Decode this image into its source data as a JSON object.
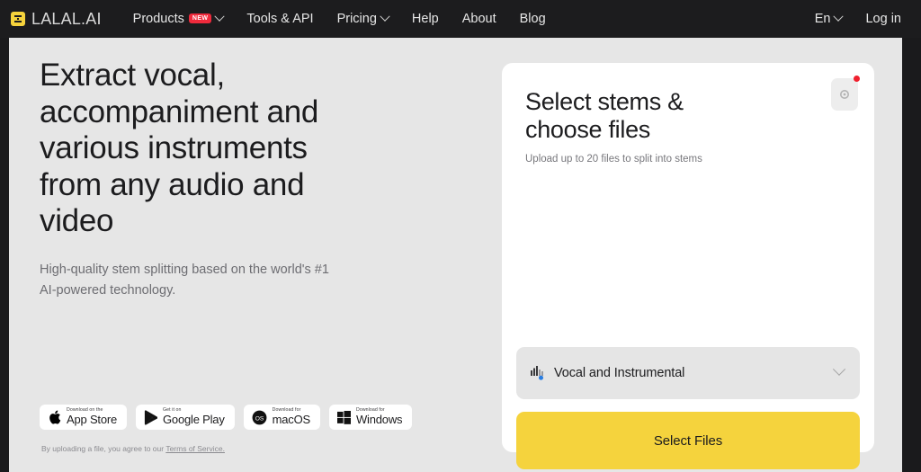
{
  "nav": {
    "brand": "LALAL.AI",
    "items": [
      {
        "label": "Products",
        "badge": "NEW",
        "caret": true
      },
      {
        "label": "Tools & API",
        "caret": false
      },
      {
        "label": "Pricing",
        "caret": true
      },
      {
        "label": "Help",
        "caret": false
      },
      {
        "label": "About",
        "caret": false
      },
      {
        "label": "Blog",
        "caret": false
      }
    ],
    "language": "En",
    "login": "Log in"
  },
  "hero": {
    "title": "Extract vocal, accompaniment and various instruments from any audio and video",
    "subtitle": "High-quality stem splitting based on the world's #1 AI-powered technology."
  },
  "badges": [
    {
      "top": "Download on the",
      "main": "App Store",
      "icon": "apple-icon"
    },
    {
      "top": "Get it on",
      "main": "Google Play",
      "icon": "google-play-icon"
    },
    {
      "top": "Download for",
      "main": "macOS",
      "icon": "macos-icon"
    },
    {
      "top": "Download for",
      "main": "Windows",
      "icon": "windows-icon"
    }
  ],
  "legal": {
    "prefix": "By uploading a file, you agree to our ",
    "link": "Terms of Service."
  },
  "card": {
    "title": "Select stems & choose files",
    "subtitle": "Upload up to 20 files to split into stems",
    "settings_icon": "gear-icon",
    "stem_selector": {
      "value": "Vocal and Instrumental",
      "icon": "stem-waveform-icon"
    },
    "primary_button": "Select Files"
  },
  "colors": {
    "brand_yellow": "#f5d33d",
    "nav_background": "#1c1c1e",
    "page_background": "#e6e6e6",
    "card_background": "#ffffff",
    "alert_red": "#f0202e",
    "badge_red": "#ef2a3c",
    "accent_blue": "#2a7de1"
  }
}
